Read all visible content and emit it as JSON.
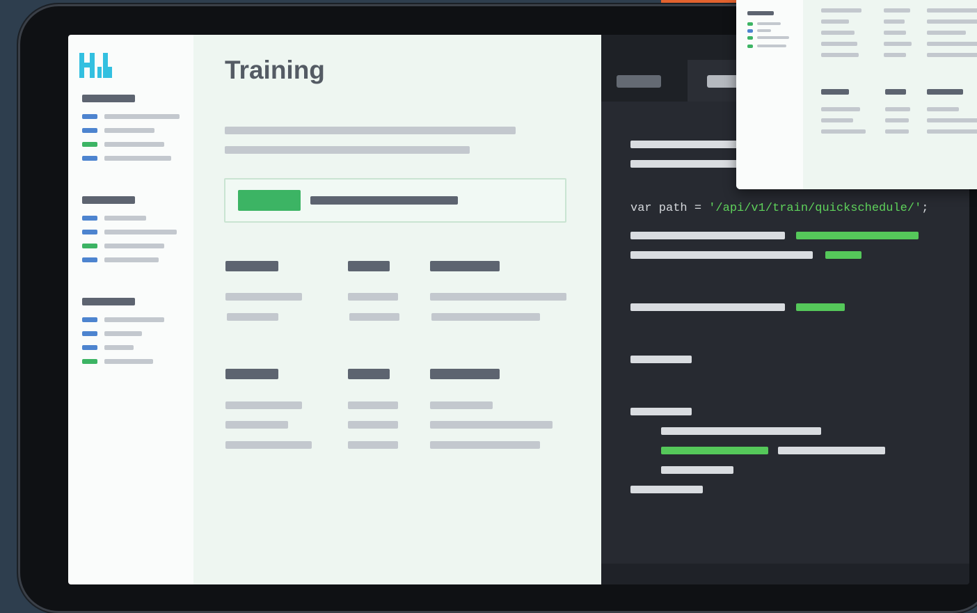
{
  "app": {
    "logo_icon": "brand-logo-icon",
    "accent_color": "#33c0e0"
  },
  "main": {
    "title": "Training",
    "status_badge_color": "#3cb464"
  },
  "code_panel": {
    "code_prefix": "var path = ",
    "code_string": "'/api/v1/train/quickschedule/'",
    "code_suffix": ";",
    "string_color": "#5fd35b"
  },
  "colors": {
    "nav_blue": "#4d84cf",
    "nav_green": "#3cb464",
    "background": "#2e3e4e",
    "device_frame": "#0f1114"
  }
}
